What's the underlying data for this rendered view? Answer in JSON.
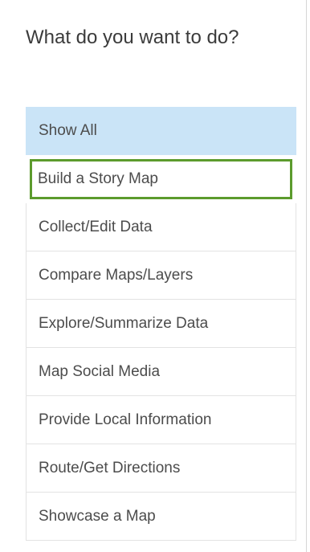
{
  "panel": {
    "heading": "What do you want to do?"
  },
  "menu": {
    "items": [
      {
        "label": "Show All"
      },
      {
        "label": "Build a Story Map"
      },
      {
        "label": "Collect/Edit Data"
      },
      {
        "label": "Compare Maps/Layers"
      },
      {
        "label": "Explore/Summarize Data"
      },
      {
        "label": "Map Social Media"
      },
      {
        "label": "Provide Local Information"
      },
      {
        "label": "Route/Get Directions"
      },
      {
        "label": "Showcase a Map"
      }
    ]
  },
  "colors": {
    "active_background": "#cae4f7",
    "highlight_outline": "#5c9b2d",
    "item_border": "#e3e3e3",
    "text": "#4c4c4c"
  }
}
